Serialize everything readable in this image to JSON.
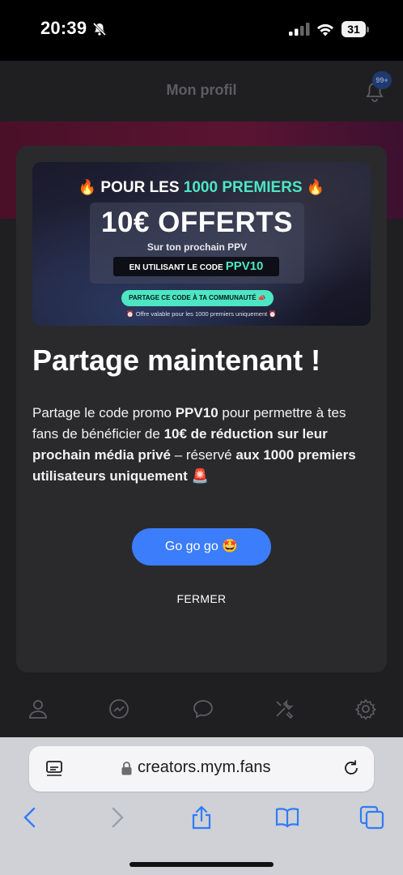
{
  "status_bar": {
    "time": "20:39",
    "battery": "31"
  },
  "header": {
    "title": "Mon profil",
    "notification_count": "99+"
  },
  "promo_banner": {
    "headline_prefix": "POUR LES ",
    "headline_highlight": "1000 PREMIERS",
    "amount": "10€ OFFERTS",
    "subtitle": "Sur ton prochain PPV",
    "code_label": "EN UTILISANT LE CODE",
    "code": "PPV10",
    "share_label": "PARTAGE CE CODE À TA COMMUNAUTÉ",
    "footnote": "Offre valable pour les 1000 premiers uniquement"
  },
  "modal": {
    "title": "Partage maintenant !",
    "body_1": "Partage le code promo ",
    "body_code": "PPV10",
    "body_2": " pour permettre à tes fans de bénéficier de ",
    "body_bold_1": "10€ de réduction sur leur prochain média privé",
    "body_3": " – réservé ",
    "body_bold_2": "aux 1000 premiers utilisateurs uniquement",
    "cta_label": "Go go go",
    "close_label": "FERMER"
  },
  "tabbar": {
    "icons": [
      "user-icon",
      "trending-icon",
      "chat-icon",
      "tools-icon",
      "settings-icon"
    ]
  },
  "browser": {
    "url": "creators.mym.fans"
  },
  "colors": {
    "accent_teal": "#4de6c3",
    "cta_blue": "#3b7dfb",
    "fire_orange": "#ff7a1a"
  }
}
